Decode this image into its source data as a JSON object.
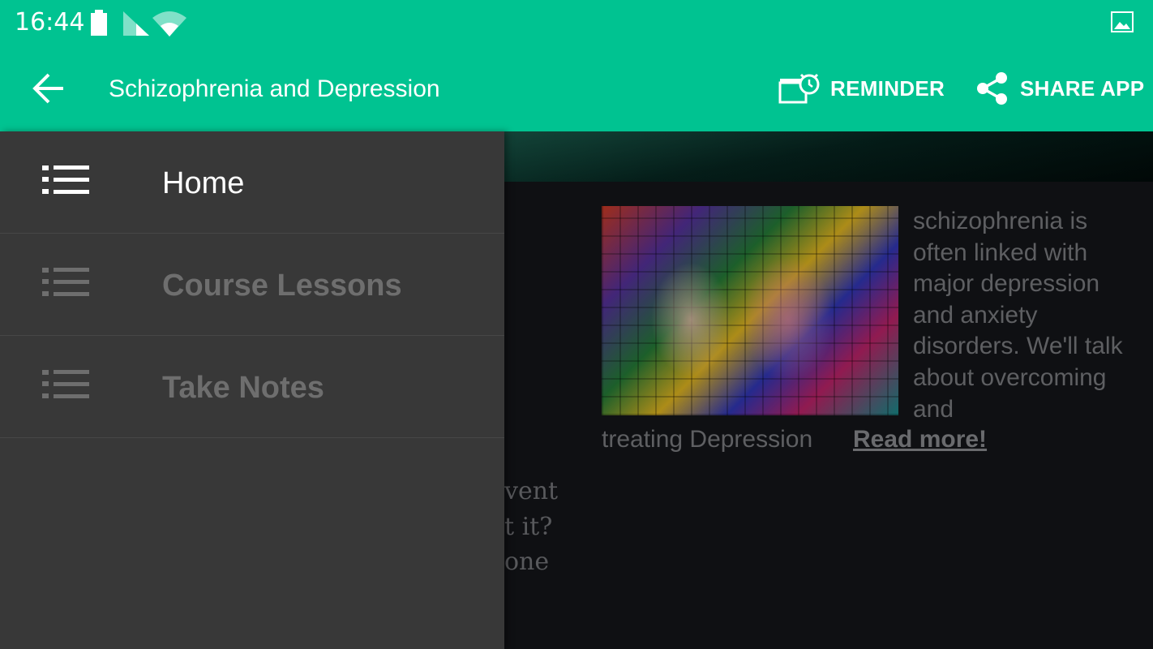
{
  "status_bar": {
    "time": "16:44",
    "icons": [
      "battery-icon",
      "signal-icon",
      "wifi-icon",
      "image-notification-icon"
    ]
  },
  "app_bar": {
    "title": "Schizophrenia and Depression",
    "back_icon": "arrow-left-icon",
    "actions": [
      {
        "label": "REMINDER",
        "icon": "alarm-clapperboard-icon"
      },
      {
        "label": "SHARE APP",
        "icon": "share-icon"
      }
    ],
    "color": "#00c391"
  },
  "drawer": {
    "items": [
      {
        "label": "Home",
        "icon": "list-icon",
        "active": true
      },
      {
        "label": "Course Lessons",
        "icon": "list-icon",
        "active": false
      },
      {
        "label": "Take Notes",
        "icon": "list-icon",
        "active": false
      }
    ]
  },
  "content": {
    "article": {
      "text": "schizophrenia is often linked with major depression and anxiety disorders. We'll talk about overcoming and",
      "tail": "treating Depression",
      "read_more": "Read more!"
    },
    "peek_lines": [
      "vent",
      "t it?",
      "one"
    ]
  }
}
